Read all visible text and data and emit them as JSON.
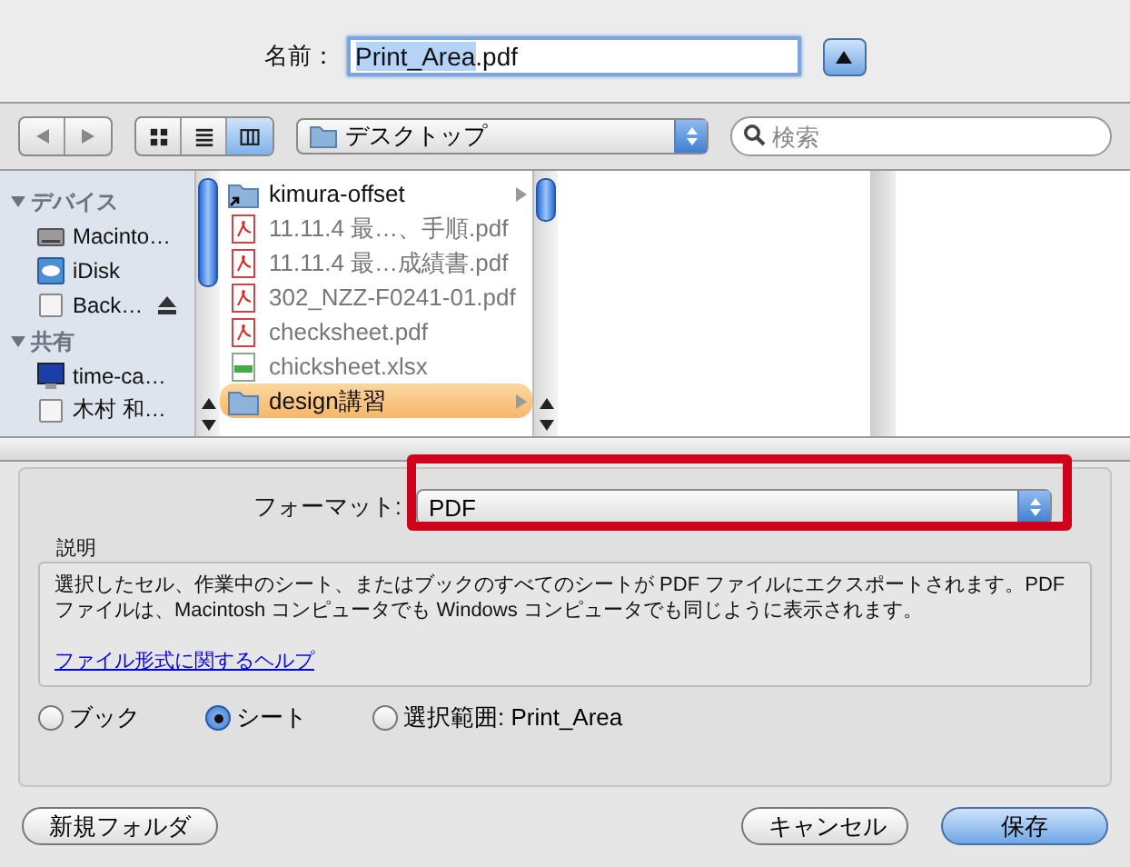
{
  "name_row": {
    "label": "名前：",
    "value_parts": [
      {
        "text": "Print_Area",
        "selected": true
      },
      {
        "text": ".pdf",
        "selected": false
      }
    ],
    "expanded": true
  },
  "toolbar": {
    "view_modes": [
      {
        "kind": "icon",
        "selected": false
      },
      {
        "kind": "list",
        "selected": false
      },
      {
        "kind": "column",
        "selected": true
      }
    ],
    "location": "デスクトップ",
    "search": {
      "placeholder": "検索"
    }
  },
  "sidebar": {
    "sections": [
      {
        "title": "デバイス",
        "expanded": true,
        "items": [
          {
            "label": "Macinto…",
            "kind": "disk",
            "eject": false
          },
          {
            "label": "iDisk",
            "kind": "idisk",
            "eject": false
          },
          {
            "label": "Back…",
            "kind": "drive",
            "eject": true
          }
        ]
      },
      {
        "title": "共有",
        "expanded": true,
        "items": [
          {
            "label": "time-ca…",
            "kind": "monitor",
            "eject": false
          },
          {
            "label": "木村 和…",
            "kind": "drive",
            "eject": false
          }
        ]
      }
    ]
  },
  "files": [
    {
      "name": "kimura-offset",
      "kind": "alias_folder",
      "disabled": false,
      "selected": false
    },
    {
      "name": "11.11.4 最…、手順.pdf",
      "kind": "pdf",
      "disabled": true,
      "selected": false
    },
    {
      "name": "11.11.4 最…成績書.pdf",
      "kind": "pdf",
      "disabled": true,
      "selected": false
    },
    {
      "name": "302_NZZ-F0241-01.pdf",
      "kind": "pdf",
      "disabled": true,
      "selected": false
    },
    {
      "name": "checksheet.pdf",
      "kind": "pdf",
      "disabled": true,
      "selected": false
    },
    {
      "name": "chicksheet.xlsx",
      "kind": "xlsx",
      "disabled": true,
      "selected": false
    },
    {
      "name": "design講習",
      "kind": "folder",
      "disabled": false,
      "selected": true
    }
  ],
  "options": {
    "format_label": "フォーマット:",
    "format": "PDF",
    "description_label": "説明",
    "description": "選択したセル、作業中のシート、またはブックのすべてのシートが PDF ファイルにエクスポートされます。PDF ファイルは、Macintosh コンピュータでも Windows コンピュータでも同じように表示されます。",
    "help_link": "ファイル形式に関するヘルプ",
    "scope": [
      {
        "label": "ブック",
        "selected": false
      },
      {
        "label": "シート",
        "selected": true
      },
      {
        "label": "選択範囲: Print_Area",
        "selected": false
      }
    ]
  },
  "buttons": {
    "new_folder": "新規フォルダ",
    "cancel": "キャンセル",
    "save": "保存"
  }
}
